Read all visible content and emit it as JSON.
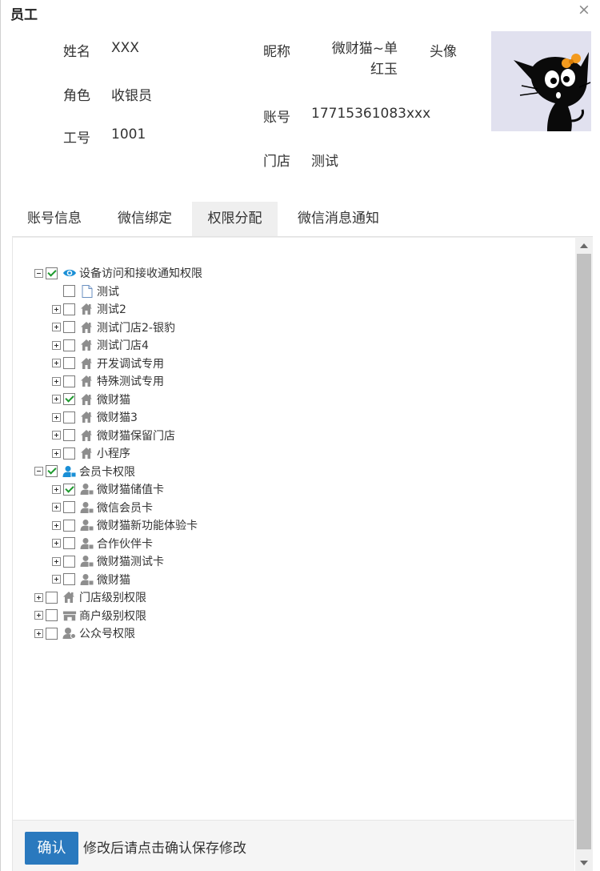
{
  "dialog": {
    "title": "员工",
    "close_glyph": "×"
  },
  "profile": {
    "name_label": "姓名",
    "name_value": "XXX",
    "role_label": "角色",
    "role_value": "收银员",
    "employee_no_label": "工号",
    "employee_no_value": "1001",
    "nickname_label": "昵称",
    "nickname_value_line1": "微财猫~单",
    "nickname_value_line2": "红玉",
    "account_label": "账号",
    "account_value": "17715361083xxx",
    "store_label": "门店",
    "store_value": "测试",
    "avatar_label": "头像"
  },
  "tabs": [
    {
      "label": "账号信息",
      "active": false
    },
    {
      "label": "微信绑定",
      "active": false
    },
    {
      "label": "权限分配",
      "active": true
    },
    {
      "label": "微信消息通知",
      "active": false
    }
  ],
  "tree": [
    {
      "label": "设备访问和接收通知权限",
      "level": 0,
      "expander": "minus",
      "checked": true,
      "icon": "eye-icon"
    },
    {
      "label": "测试",
      "level": 1,
      "expander": "none",
      "checked": false,
      "icon": "document-icon"
    },
    {
      "label": "测试2",
      "level": 1,
      "expander": "plus",
      "checked": false,
      "icon": "store-icon"
    },
    {
      "label": "测试门店2-银豹",
      "level": 1,
      "expander": "plus",
      "checked": false,
      "icon": "store-icon"
    },
    {
      "label": "测试门店4",
      "level": 1,
      "expander": "plus",
      "checked": false,
      "icon": "store-icon"
    },
    {
      "label": "开发调试专用",
      "level": 1,
      "expander": "plus",
      "checked": false,
      "icon": "store-icon"
    },
    {
      "label": "特殊测试专用",
      "level": 1,
      "expander": "plus",
      "checked": false,
      "icon": "store-icon"
    },
    {
      "label": "微财猫",
      "level": 1,
      "expander": "plus",
      "checked": true,
      "icon": "store-icon"
    },
    {
      "label": "微财猫3",
      "level": 1,
      "expander": "plus",
      "checked": false,
      "icon": "store-icon"
    },
    {
      "label": "微财猫保留门店",
      "level": 1,
      "expander": "plus",
      "checked": false,
      "icon": "store-icon"
    },
    {
      "label": "小程序",
      "level": 1,
      "expander": "plus",
      "checked": false,
      "icon": "store-icon"
    },
    {
      "label": "会员卡权限",
      "level": 0,
      "expander": "minus",
      "checked": true,
      "icon": "member-blue-icon"
    },
    {
      "label": "微财猫储值卡",
      "level": 1,
      "expander": "plus",
      "checked": true,
      "icon": "member-card-icon"
    },
    {
      "label": "微信会员卡",
      "level": 1,
      "expander": "plus",
      "checked": false,
      "icon": "member-card-icon"
    },
    {
      "label": "微财猫新功能体验卡",
      "level": 1,
      "expander": "plus",
      "checked": false,
      "icon": "member-card-icon"
    },
    {
      "label": "合作伙伴卡",
      "level": 1,
      "expander": "plus",
      "checked": false,
      "icon": "member-card-icon"
    },
    {
      "label": "微财猫测试卡",
      "level": 1,
      "expander": "plus",
      "checked": false,
      "icon": "member-card-icon"
    },
    {
      "label": "微财猫",
      "level": 1,
      "expander": "plus",
      "checked": false,
      "icon": "member-card-icon"
    },
    {
      "label": "门店级别权限",
      "level": 0,
      "expander": "plus",
      "checked": false,
      "icon": "store-icon"
    },
    {
      "label": "商户级别权限",
      "level": 0,
      "expander": "plus",
      "checked": false,
      "icon": "merchant-icon"
    },
    {
      "label": "公众号权限",
      "level": 0,
      "expander": "plus",
      "checked": false,
      "icon": "official-account-icon"
    }
  ],
  "footer": {
    "confirm_label": "确认",
    "hint": "修改后请点击确认保存修改"
  },
  "colors": {
    "primary_button": "#2a79be",
    "check_green": "#1e9a2e",
    "eye_blue": "#1a8fd6",
    "icon_gray": "#8e8e8e",
    "tab_active_bg": "#efefef"
  }
}
